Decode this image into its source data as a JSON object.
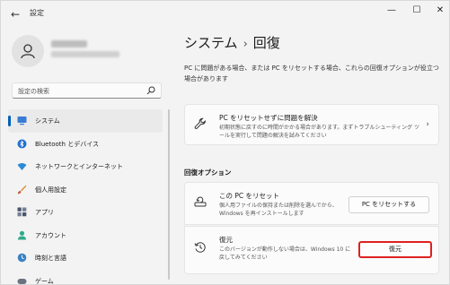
{
  "window": {
    "app_title": "設定",
    "controls": {
      "minimize": "—",
      "maximize": "☐",
      "close": "✕"
    }
  },
  "sidebar": {
    "search_placeholder": "設定の検索",
    "items": [
      {
        "label": "システム",
        "icon": "system-icon",
        "active": true
      },
      {
        "label": "Bluetooth とデバイス",
        "icon": "bluetooth-icon"
      },
      {
        "label": "ネットワークとインターネット",
        "icon": "wifi-icon"
      },
      {
        "label": "個人用設定",
        "icon": "brush-icon"
      },
      {
        "label": "アプリ",
        "icon": "apps-icon"
      },
      {
        "label": "アカウント",
        "icon": "account-icon"
      },
      {
        "label": "時刻と言語",
        "icon": "time-language-icon"
      },
      {
        "label": "ゲーム",
        "icon": "game-icon"
      }
    ]
  },
  "main": {
    "breadcrumb": {
      "parent": "システム",
      "separator": "›",
      "current": "回復"
    },
    "description": "PC に問題がある場合、または PC をリセットする場合、これらの回復オプションが役立つ場合があります",
    "fix_card": {
      "title": "PC をリセットせずに問題を解決",
      "subtitle": "初期状態に戻すのに時間がかかる場合があります。まずトラブルシューティング ツールを実行して問題の解決を試みてください"
    },
    "section_heading": "回復オプション",
    "reset_card": {
      "title": "この PC をリセット",
      "subtitle": "個人用ファイルの保持または削除を選んでから、Windows を再インストールします",
      "button": "PC をリセットする"
    },
    "restore_card": {
      "title": "復元",
      "subtitle": "このバージョンが動作しない場合は、Windows 10 に戻してみてください",
      "button": "復元"
    }
  },
  "colors": {
    "accent": "#005fb8",
    "highlight": "#e02020"
  }
}
